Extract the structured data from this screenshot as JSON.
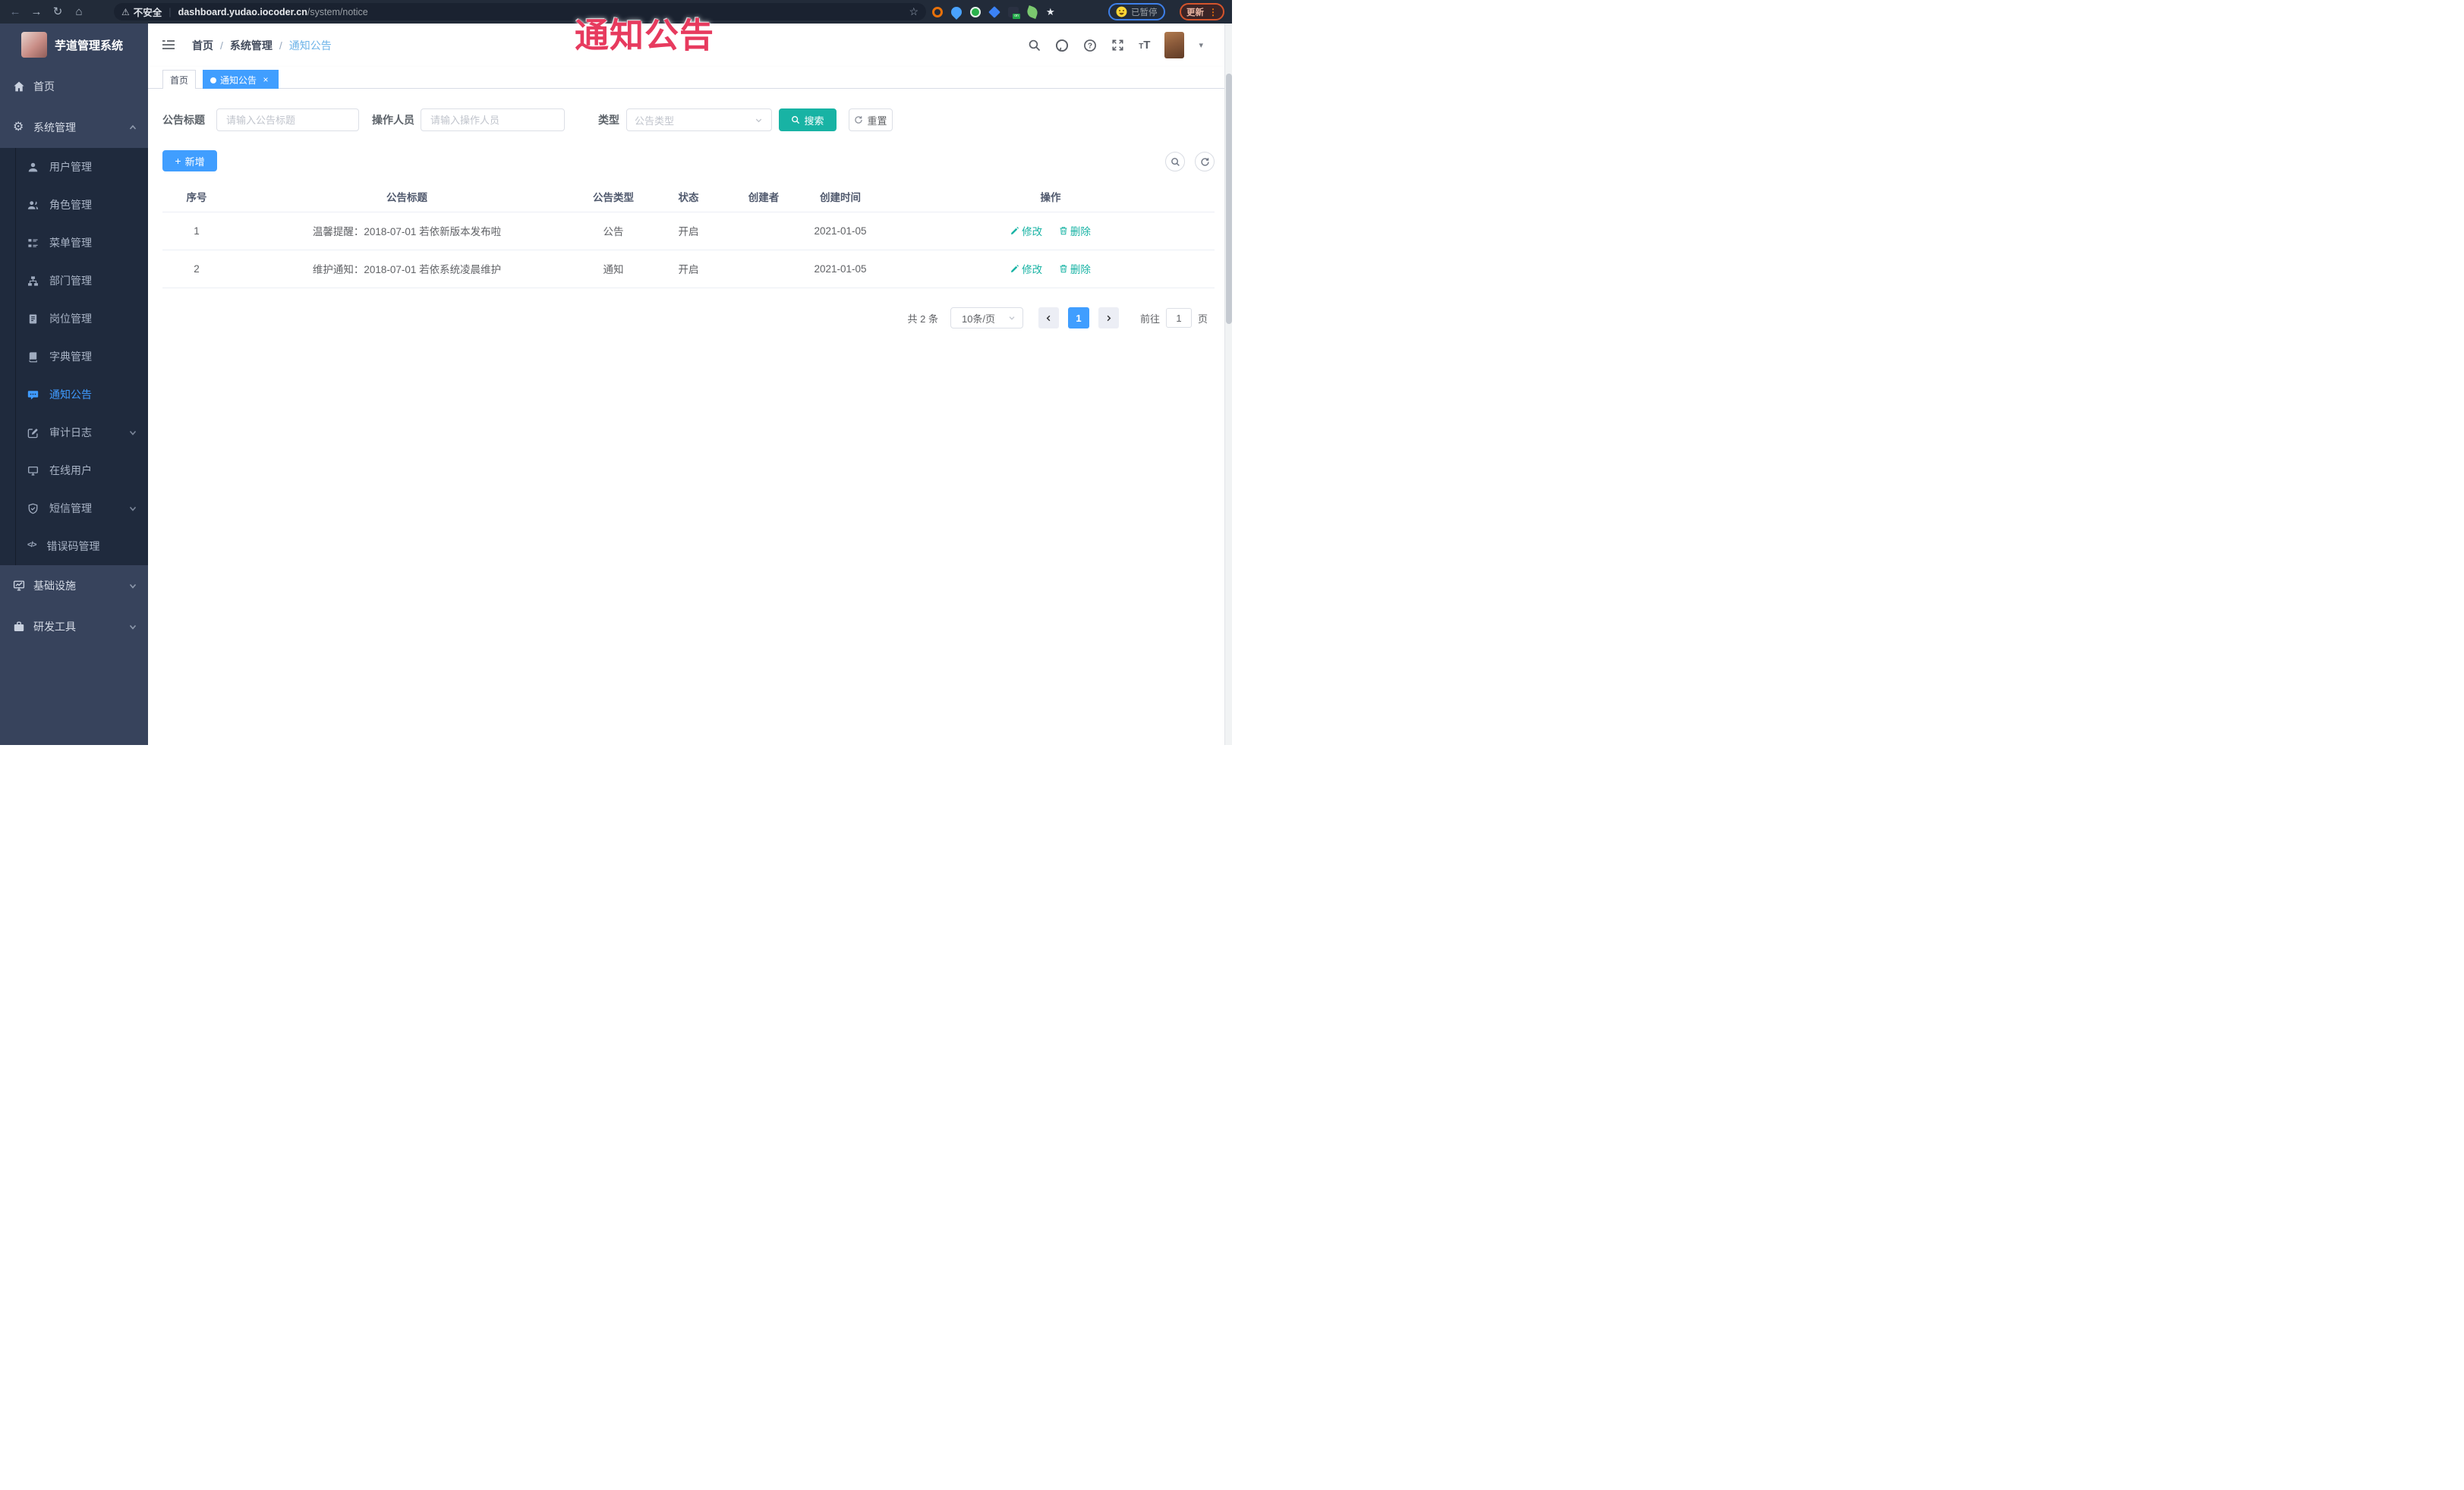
{
  "browser": {
    "security_warning": "不安全",
    "url_host": "dashboard.yudao.iocoder.cn",
    "url_path": "/system/notice",
    "paused_badge": "已暂停",
    "update_button": "更新"
  },
  "glyphs": {
    "back": "←",
    "forward": "→",
    "reload": "↻",
    "home": "⌂",
    "warning": "⚠",
    "star": "☆",
    "kebab": "⋮",
    "gear": "⚙",
    "puzzle": "★",
    "code": "</>",
    "plus": "+",
    "close": "×",
    "sep": "/",
    "caret": "▾"
  },
  "watermark": "通知公告",
  "sidebar": {
    "logo_title": "芋道管理系统",
    "home": "首页",
    "system": "系统管理",
    "submenu": [
      "用户管理",
      "角色管理",
      "菜单管理",
      "部门管理",
      "岗位管理",
      "字典管理",
      "通知公告",
      "审计日志",
      "在线用户",
      "短信管理",
      "错误码管理"
    ],
    "bottom": [
      "基础设施",
      "研发工具"
    ]
  },
  "navbar": {
    "breadcrumb": [
      "首页",
      "系统管理",
      "通知公告"
    ]
  },
  "tabs": {
    "home": "首页",
    "active": "通知公告"
  },
  "form": {
    "title_label": "公告标题",
    "title_placeholder": "请输入公告标题",
    "operator_label": "操作人员",
    "operator_placeholder": "请输入操作人员",
    "type_label": "类型",
    "type_placeholder": "公告类型",
    "search_button": "搜索",
    "reset_button": "重置"
  },
  "toolbar": {
    "add_button": "新增"
  },
  "table": {
    "headers": [
      "序号",
      "公告标题",
      "公告类型",
      "状态",
      "创建者",
      "创建时间",
      "操作"
    ],
    "rows": [
      {
        "no": "1",
        "title": "温馨提醒：2018-07-01 若依新版本发布啦",
        "type": "公告",
        "status": "开启",
        "creator": "",
        "create_time": "2021-01-05",
        "edit": "修改",
        "delete": "删除"
      },
      {
        "no": "2",
        "title": "维护通知：2018-07-01 若依系统凌晨维护",
        "type": "通知",
        "status": "开启",
        "creator": "",
        "create_time": "2021-01-05",
        "edit": "修改",
        "delete": "删除"
      }
    ]
  },
  "pagination": {
    "total": "共 2 条",
    "page_size": "10条/页",
    "current_page": "1",
    "goto_label": "前往",
    "goto_value": "1",
    "page_unit": "页"
  },
  "colors": {
    "primary_blue": "#409eff",
    "teal_action": "#18b3a4",
    "watermark_red": "#e73a5e",
    "sidebar_bg": "#37435c",
    "submenu_bg": "#1f2a3d",
    "browser_bar": "#222b39",
    "active_menu_text": "#3f9bff"
  }
}
